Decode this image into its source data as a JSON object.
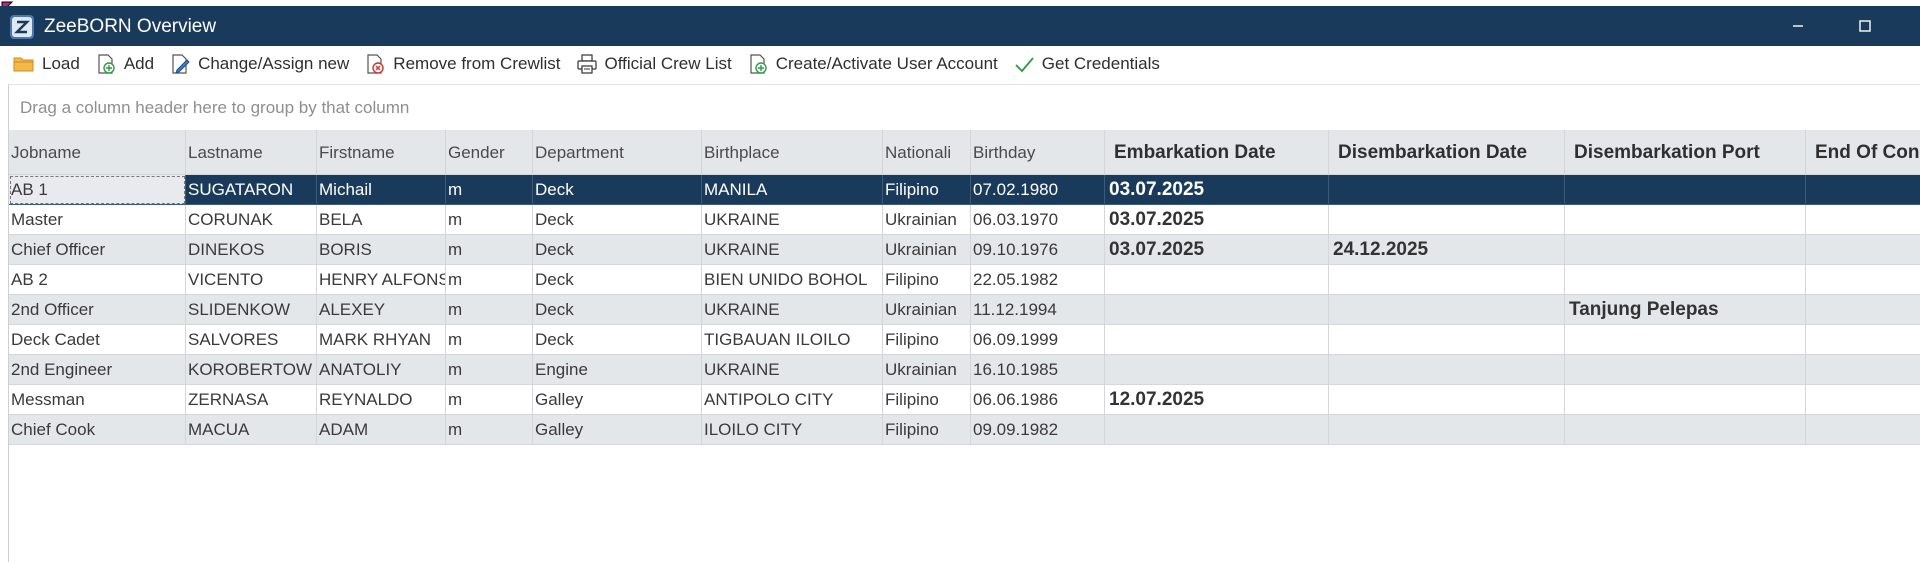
{
  "window": {
    "title": "ZeeBORN Overview",
    "titlebar_color": "#1a3a5c",
    "app_icon": "zeeborn-app-icon"
  },
  "toolbar": {
    "items": [
      {
        "label": "Load",
        "icon": "folder-icon"
      },
      {
        "label": "Add",
        "icon": "add-document-icon"
      },
      {
        "label": "Change/Assign new",
        "icon": "edit-document-icon"
      },
      {
        "label": "Remove from Crewlist",
        "icon": "remove-document-icon"
      },
      {
        "label": "Official Crew List",
        "icon": "printer-icon"
      },
      {
        "label": "Create/Activate User Account",
        "icon": "add-user-document-icon"
      },
      {
        "label": "Get Credentials",
        "icon": "checkmark-icon"
      }
    ]
  },
  "group_panel": {
    "placeholder": "Drag a column header here to group by that column"
  },
  "grid": {
    "columns": [
      "Jobname",
      "Lastname",
      "Firstname",
      "Gender",
      "Department",
      "Birthplace",
      "Nationali",
      "Birthday",
      "Embarkation Date",
      "Disembarkation Date",
      "Disembarkation Port",
      "End Of Con"
    ],
    "rows": [
      [
        "AB 1",
        "SUGATARON",
        "Michail",
        "m",
        "Deck",
        "MANILA",
        "Filipino",
        "07.02.1980",
        "03.07.2025",
        "",
        "",
        ""
      ],
      [
        "Master",
        "CORUNAK",
        "BELA",
        "m",
        "Deck",
        "UKRAINE",
        "Ukrainian",
        "06.03.1970",
        "03.07.2025",
        "",
        "",
        ""
      ],
      [
        "Chief Officer",
        "DINEKOS",
        "BORIS",
        "m",
        "Deck",
        "UKRAINE",
        "Ukrainian",
        "09.10.1976",
        "03.07.2025",
        "24.12.2025",
        "",
        ""
      ],
      [
        "AB 2",
        "VICENTO",
        "HENRY ALFONS",
        "m",
        "Deck",
        "BIEN UNIDO BOHOL",
        "Filipino",
        "22.05.1982",
        "",
        "",
        "",
        ""
      ],
      [
        "2nd Officer",
        "SLIDENKOW",
        "ALEXEY",
        "m",
        "Deck",
        "UKRAINE",
        "Ukrainian",
        "11.12.1994",
        "",
        "",
        "Tanjung Pelepas",
        ""
      ],
      [
        "Deck Cadet",
        "SALVORES",
        "MARK RHYAN",
        "m",
        "Deck",
        "TIGBAUAN ILOILO",
        "Filipino",
        "06.09.1999",
        "",
        "",
        "",
        ""
      ],
      [
        "2nd Engineer",
        "KOROBERTOW",
        "ANATOLIY",
        "m",
        "Engine",
        "UKRAINE",
        "Ukrainian",
        "16.10.1985",
        "",
        "",
        "",
        ""
      ],
      [
        "Messman",
        "ZERNASA",
        "REYNALDO",
        "m",
        "Galley",
        "ANTIPOLO CITY",
        "Filipino",
        "06.06.1986",
        "12.07.2025",
        "",
        "",
        ""
      ],
      [
        "Chief Cook",
        "MACUA",
        "ADAM",
        "m",
        "Galley",
        "ILOILO CITY",
        "Filipino",
        "09.09.1982",
        "",
        "",
        "",
        ""
      ]
    ],
    "selected_row": 0
  }
}
